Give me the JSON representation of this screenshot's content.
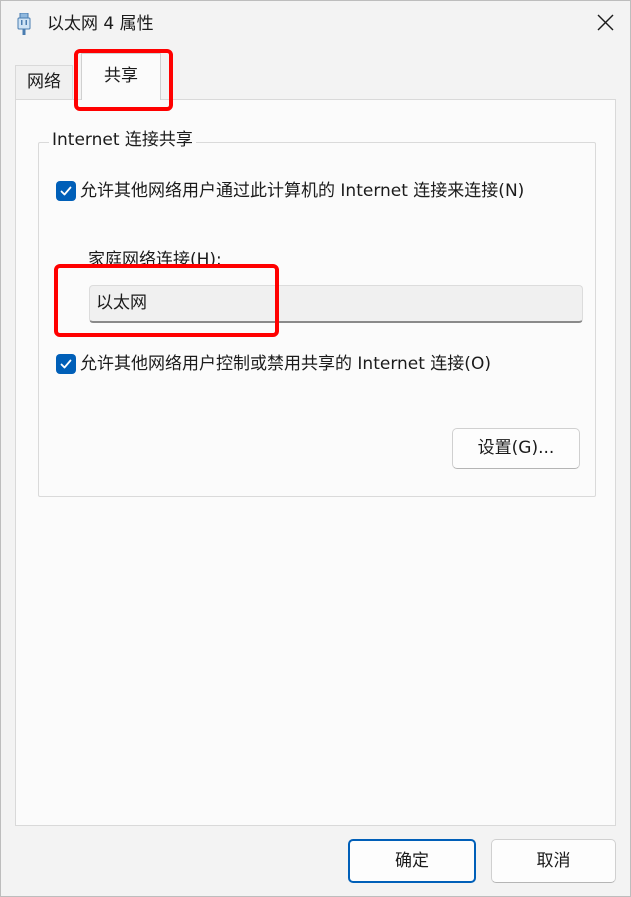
{
  "window": {
    "title": "以太网 4 属性",
    "title_icon": "network-adapter-icon",
    "close_icon": "close-icon"
  },
  "tabs": [
    {
      "label": "网络",
      "selected": false
    },
    {
      "label": "共享",
      "selected": true
    }
  ],
  "sharing": {
    "group_title": "Internet 连接共享",
    "allow_share": {
      "label": "允许其他网络用户通过此计算机的 Internet 连接来连接(N)",
      "checked": true
    },
    "home_network_label": "家庭网络连接(H):",
    "home_network_value": "以太网",
    "allow_control": {
      "label": "允许其他网络用户控制或禁用共享的 Internet 连接(O)",
      "checked": true
    },
    "settings_button": "设置(G)..."
  },
  "footer": {
    "ok_label": "确定",
    "cancel_label": "取消"
  },
  "colors": {
    "accent": "#005fb8",
    "annotation": "#ff0000",
    "background": "#f3f3f3",
    "panel": "#fbfbfb"
  }
}
